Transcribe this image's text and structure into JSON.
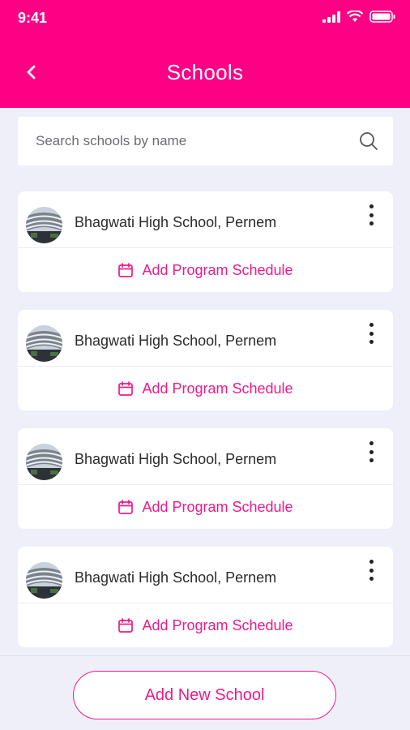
{
  "status_bar": {
    "time": "9:41"
  },
  "header": {
    "title": "Schools"
  },
  "search": {
    "placeholder": "Search schools by name"
  },
  "schools": [
    {
      "name": "Bhagwati High School, Pernem",
      "action_label": "Add Program Schedule"
    },
    {
      "name": "Bhagwati High School, Pernem",
      "action_label": "Add Program Schedule"
    },
    {
      "name": "Bhagwati High School, Pernem",
      "action_label": "Add Program Schedule"
    },
    {
      "name": "Bhagwati High School, Pernem",
      "action_label": "Add Program Schedule"
    }
  ],
  "footer": {
    "add_button_label": "Add New School"
  },
  "colors": {
    "brand": "#fe0084",
    "accent": "#ec1b8c",
    "background": "#efeffa"
  },
  "icons": {
    "back": "chevron-left-icon",
    "search": "search-icon",
    "menu": "kebab-menu-icon",
    "calendar": "calendar-icon"
  }
}
